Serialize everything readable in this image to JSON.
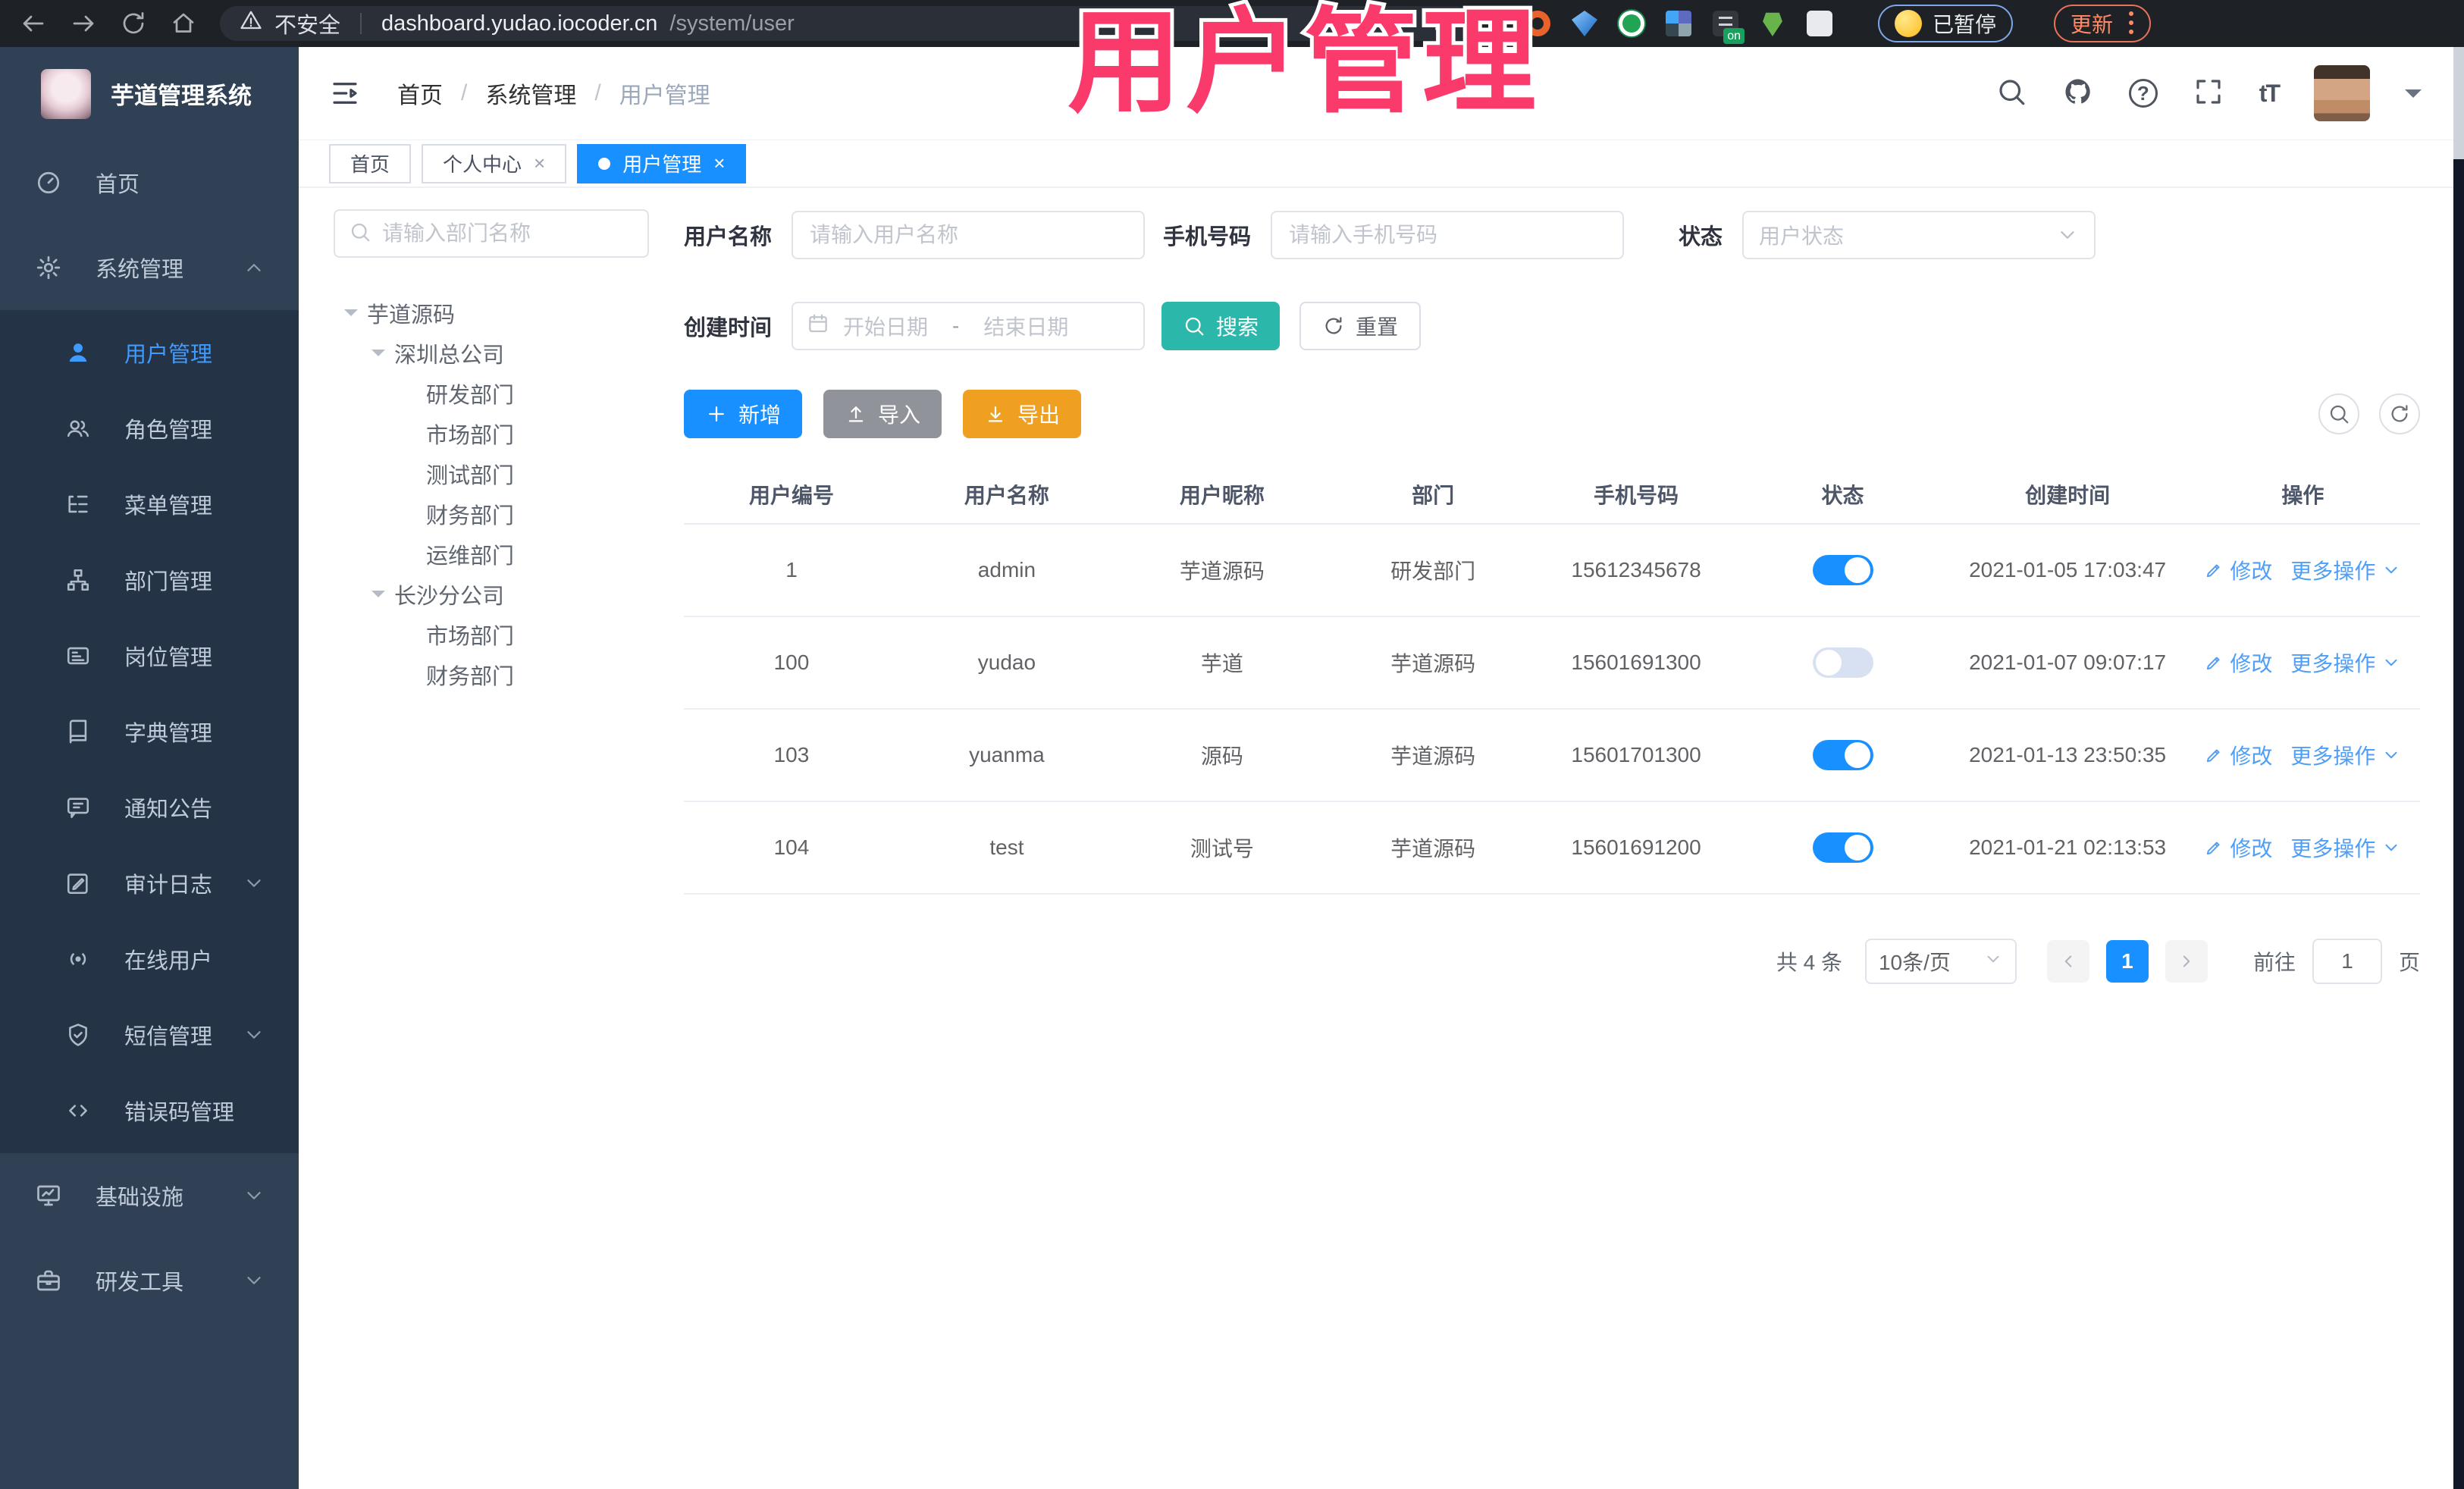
{
  "browser": {
    "security": "不安全",
    "url_host": "dashboard.yudao.iocoder.cn",
    "url_path": "/system/user",
    "ext_badge": "on",
    "paused": "已暂停",
    "update": "更新"
  },
  "overlay": {
    "title": "用户管理"
  },
  "icons": {
    "close": "×",
    "slash": "/",
    "question": "?",
    "font_size": "tT"
  },
  "app": {
    "title": "芋道管理系统",
    "breadcrumb": [
      "首页",
      "系统管理",
      "用户管理"
    ],
    "tabs": [
      {
        "label": "首页"
      },
      {
        "label": "个人中心"
      },
      {
        "label": "用户管理"
      }
    ]
  },
  "sidebar": {
    "items": [
      {
        "label": "首页"
      },
      {
        "label": "系统管理"
      },
      {
        "label": "用户管理"
      },
      {
        "label": "角色管理"
      },
      {
        "label": "菜单管理"
      },
      {
        "label": "部门管理"
      },
      {
        "label": "岗位管理"
      },
      {
        "label": "字典管理"
      },
      {
        "label": "通知公告"
      },
      {
        "label": "审计日志"
      },
      {
        "label": "在线用户"
      },
      {
        "label": "短信管理"
      },
      {
        "label": "错误码管理"
      },
      {
        "label": "基础设施"
      },
      {
        "label": "研发工具"
      }
    ]
  },
  "tree": {
    "search_placeholder": "请输入部门名称",
    "nodes": [
      {
        "label": "芋道源码",
        "level": 1
      },
      {
        "label": "深圳总公司",
        "level": 2
      },
      {
        "label": "研发部门",
        "level": 3
      },
      {
        "label": "市场部门",
        "level": 3
      },
      {
        "label": "测试部门",
        "level": 3
      },
      {
        "label": "财务部门",
        "level": 3
      },
      {
        "label": "运维部门",
        "level": 3
      },
      {
        "label": "长沙分公司",
        "level": 2
      },
      {
        "label": "市场部门",
        "level": 3
      },
      {
        "label": "财务部门",
        "level": 3
      }
    ]
  },
  "filters": {
    "username_label": "用户名称",
    "username_placeholder": "请输入用户名称",
    "mobile_label": "手机号码",
    "mobile_placeholder": "请输入手机号码",
    "status_label": "状态",
    "status_placeholder": "用户状态",
    "created_label": "创建时间",
    "date_start_placeholder": "开始日期",
    "date_separator": "-",
    "date_end_placeholder": "结束日期",
    "search_button": "搜索",
    "reset_button": "重置"
  },
  "toolbar": {
    "add": "新增",
    "import": "导入",
    "export": "导出"
  },
  "table": {
    "headers": [
      "用户编号",
      "用户名称",
      "用户昵称",
      "部门",
      "手机号码",
      "状态",
      "创建时间",
      "操作"
    ],
    "action_edit": "修改",
    "action_more": "更多操作",
    "rows": [
      {
        "id": "1",
        "username": "admin",
        "nickname": "芋道源码",
        "dept": "研发部门",
        "mobile": "15612345678",
        "status": true,
        "created": "2021-01-05 17:03:47"
      },
      {
        "id": "100",
        "username": "yudao",
        "nickname": "芋道",
        "dept": "芋道源码",
        "mobile": "15601691300",
        "status": false,
        "created": "2021-01-07 09:07:17"
      },
      {
        "id": "103",
        "username": "yuanma",
        "nickname": "源码",
        "dept": "芋道源码",
        "mobile": "15601701300",
        "status": true,
        "created": "2021-01-13 23:50:35"
      },
      {
        "id": "104",
        "username": "test",
        "nickname": "测试号",
        "dept": "芋道源码",
        "mobile": "15601691200",
        "status": true,
        "created": "2021-01-21 02:13:53"
      }
    ]
  },
  "pagination": {
    "total": "共 4 条",
    "page_size": "10条/页",
    "current_page": "1",
    "goto_label": "前往",
    "goto_value": "1",
    "page_unit": "页"
  },
  "colors": {
    "primary": "#1890ff",
    "search_teal": "#2bb7a9",
    "export_amber": "#f0a020",
    "import_gray": "#909399",
    "link_blue": "#4f9ef8",
    "overlay_pink": "#fa3a6b",
    "sidebar_bg": "#304156",
    "submenu_bg": "#253346"
  }
}
